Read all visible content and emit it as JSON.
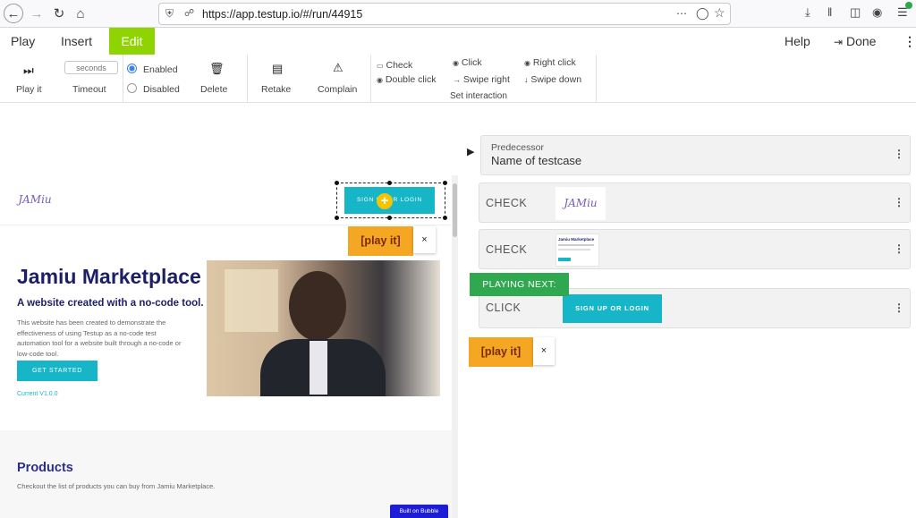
{
  "browser": {
    "url": "https://app.testup.io/#/run/44915",
    "icons": [
      "back-icon",
      "forward-icon",
      "reload-icon",
      "home-icon",
      "shield-icon",
      "lock-icon",
      "more-icon",
      "pocket-icon",
      "star-icon",
      "download-icon",
      "library-icon",
      "sidebar-icon",
      "account-icon",
      "menu-icon"
    ]
  },
  "menu": {
    "play": "Play",
    "insert": "Insert",
    "edit": "Edit",
    "help": "Help",
    "done": "Done",
    "accent": "#8fd400"
  },
  "toolbar": {
    "play_it": "Play it",
    "seconds_placeholder": "seconds",
    "timeout": "Timeout",
    "enabled": "Enabled",
    "disabled": "Disabled",
    "delete": "Delete",
    "retake": "Retake",
    "complain": "Complain",
    "interactions": {
      "check": "Check",
      "double_click": "Double click",
      "click": "Click",
      "swipe_right": "Swipe right",
      "right_click": "Right click",
      "swipe_down": "Swipe down",
      "group_label": "Set interaction"
    }
  },
  "site": {
    "logo": "JAMiu",
    "signup_button": "SIGN UP OR LOGIN",
    "hero_title": "Jamiu Marketplace",
    "hero_subtitle": "A website created with a no-code tool.",
    "hero_description": "This website has been created to demonstrate the effectiveness of using Testup as a no-code test automation tool for a website built through a no-code or low-code tool.",
    "get_started": "GET STARTED",
    "version": "Current V1.0.0",
    "products_title": "Products",
    "products_description": "Checkout the list of products you can buy from Jamiu Marketplace.",
    "bubble_badge": "Built on Bubble"
  },
  "play_tags": {
    "label": "[play it]",
    "close": "×"
  },
  "steps": {
    "predecessor_label": "Predecessor",
    "predecessor_value": "Name of testcase",
    "step1_label": "CHECK",
    "step1_thumb": "JAMiu",
    "step2_label": "CHECK",
    "step2_thumb_title": "Jamiu Marketplace",
    "playing_next": "PLAYING NEXT:",
    "step3_label": "CLICK",
    "step3_thumb": "SIGN UP OR LOGIN"
  }
}
